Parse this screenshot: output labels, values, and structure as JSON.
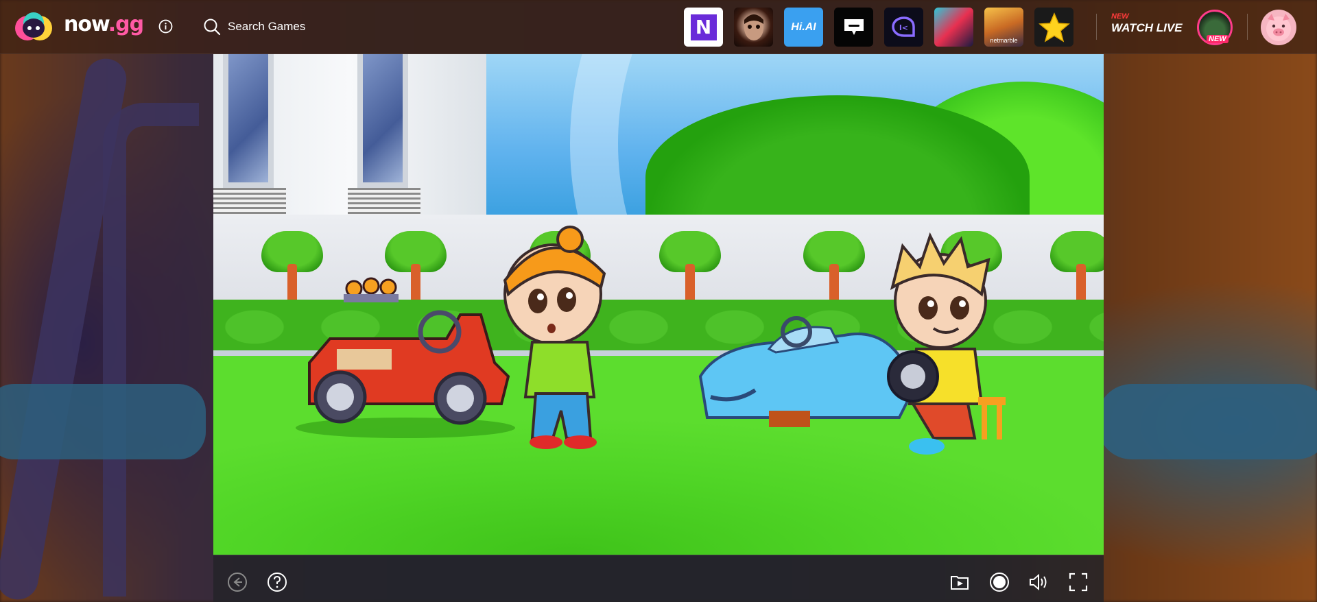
{
  "header": {
    "brand_name": "now",
    "brand_suffix": ".gg",
    "search_label": "Search Games",
    "game_tiles": [
      {
        "name": "notion-like-n-app",
        "text": "N"
      },
      {
        "name": "horror-doll-game",
        "text": ""
      },
      {
        "name": "hi-ai-app",
        "text": "Hi.AI"
      },
      {
        "name": "chat-app",
        "text": ""
      },
      {
        "name": "k-chat-app",
        "text": ""
      },
      {
        "name": "pixel-game",
        "text": ""
      },
      {
        "name": "netmarble-game",
        "text": "netmarble"
      },
      {
        "name": "star-game",
        "text": ""
      }
    ],
    "watch_live_new": "NEW",
    "watch_live_label": "WATCH LIVE",
    "live_badge": "NEW"
  },
  "colors": {
    "brand_accent": "#ff5aa5",
    "new_red": "#ff3b3b",
    "topbar_bg": "#3c2012"
  },
  "controls": {
    "left": [
      "back-icon",
      "help-icon"
    ],
    "right": [
      "screen-record-icon",
      "record-icon",
      "volume-icon",
      "fullscreen-icon"
    ]
  }
}
